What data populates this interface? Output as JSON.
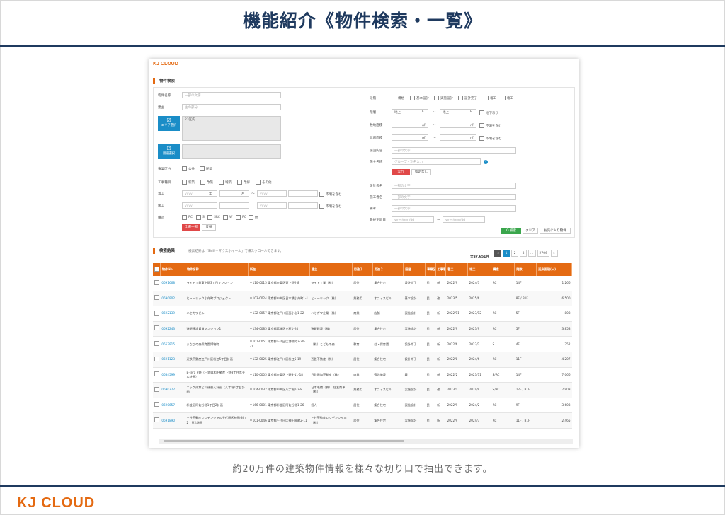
{
  "page": {
    "title": "機能紹介《物件検索・一覧》",
    "caption": "約20万件の建築物件情報を様々な切り口で抽出できます。",
    "footer_brand": "KJ CLOUD"
  },
  "app": {
    "logo": "KJ CLOUD",
    "search_section": "物件検索",
    "results_section": "検索結果",
    "results_hint": "検索結果は「Shift＋マウスホイール」で横スクロールできます。",
    "result_count": "全37,651件"
  },
  "form": {
    "name_label": "物件名称",
    "name_placeholder": "一部の文字",
    "owner_label": "建主",
    "owner_placeholder": "主の部分",
    "area_button": "エリア選択",
    "area_value": "23区内",
    "use_button": "用途選択",
    "public_label": "事業区分",
    "public_opts": [
      "公共",
      "民間"
    ],
    "work_label": "工事種目",
    "work_opts": [
      "新築",
      "改築",
      "増築",
      "改修",
      "その他"
    ],
    "start_label": "着工",
    "end_label": "竣工",
    "yyyy": "yyyy",
    "year": "年",
    "month": "月",
    "tilde": "〜",
    "include_unknown": "不明を含む",
    "struct_label": "構造",
    "struct_opts": [
      "RC",
      "S",
      "SRC",
      "W",
      "PC",
      "他"
    ],
    "clear_all": "全選一部",
    "toggle": "反転",
    "stage_label": "段階",
    "stage_opts": [
      "構想",
      "基本設計",
      "実施設計",
      "設計完了",
      "着工",
      "竣工"
    ],
    "floor_label": "階層",
    "floor_above": "地上",
    "floor_unit": "F",
    "basement": "地下あり",
    "site_label": "敷地面積",
    "total_label": "延床面積",
    "area_unit": "㎡",
    "tsubo_unit": "坪",
    "unknown_incl": "不明を含む",
    "facility_label": "施設内容",
    "facility_placeholder": "一部の文字",
    "builder_label": "施主名称",
    "builder_placeholder": "グループ・別名入力",
    "apply_btn": "実行",
    "reset_btn": "指定なし",
    "designer_label": "設計者名",
    "designer_placeholder": "一部の文字",
    "constructor_label": "施工者名",
    "constructor_placeholder": "一部の文字",
    "note_label": "備考",
    "note_placeholder": "一部の文字",
    "updated_label": "最終更新日",
    "date_placeholder": "yyyy/mm/dd",
    "search_btn": "Q 検索",
    "clear_btn": "クリア",
    "fav_btn": "お気に入り物件"
  },
  "pager": [
    "<",
    "1",
    "2",
    "3",
    "…",
    "2706",
    ">"
  ],
  "table": {
    "headers": [
      "物件No",
      "物件名称",
      "所在",
      "建主",
      "用途１",
      "用途２",
      "段階",
      "事業区分",
      "工事種目",
      "着工",
      "竣工",
      "構造",
      "階数",
      "延床面積(㎡)"
    ],
    "rows": [
      [
        "0691668",
        "ライト工業東上野3丁目マンション",
        "〒110-0015 東京都台東区東上野2-8",
        "ライト工業（株）",
        "居住",
        "集合住宅",
        "設計完了",
        "民",
        "新",
        "2022/9",
        "2024/3",
        "RC",
        "14F",
        "1,266"
      ],
      [
        "0690902",
        "ヒューリック小舟町プロジェクト",
        "〒103-0024 東京都中央区日本橋小舟町1-1",
        "ヒューリック（株）",
        "業務用",
        "オフィスビル",
        "基本設計",
        "民",
        "改",
        "2023/5",
        "2025/6",
        "",
        "8F / B1F",
        "6,500"
      ],
      [
        "0692139",
        "ハセガワビル",
        "〒132-0057 東京都江戸川区西小岩1-22",
        "ハセガワ企業（株）",
        "商業",
        "店舗",
        "実施設計",
        "民",
        "新",
        "2022/11",
        "2023/12",
        "RC",
        "5F",
        "808"
      ],
      [
        "0692243",
        "進研建設賃貸マンション1",
        "〒134-0085 東京都葛飾区立石1-24",
        "進研建設（株）",
        "居住",
        "集合住宅",
        "実施設計",
        "民",
        "新",
        "2022/9",
        "2023/9",
        "RC",
        "5F",
        "3,858"
      ],
      [
        "0657915",
        "まなびの森保育園博物町",
        "〒101-0051 東京都千代田区博物町2-20-31",
        "（株）こどもの森",
        "教育",
        "幼・保育園",
        "設計完了",
        "民",
        "新",
        "2022/6",
        "2023/2",
        "S",
        "4F",
        "752"
      ],
      [
        "0691123",
        "近鉄不動産江戸川区松江5丁目計画",
        "〒132-0025 東京都江戸川区松江5-19",
        "近鉄不動産（株）",
        "居住",
        "集合住宅",
        "設計完了",
        "民",
        "新",
        "2022/8",
        "2024/6",
        "RC",
        "11F",
        "4,207"
      ],
      [
        "0684599",
        "B-tera上野（日鉄興和不動産上野3丁目ホテル計画）",
        "〒110-0005 東京都台東区上野3-11-18",
        "日鉄興和不動産（株）",
        "商業",
        "宿泊施設",
        "着工",
        "民",
        "新",
        "2022/2",
        "2023/11",
        "S/RC",
        "14F",
        "7,066"
      ],
      [
        "0690372",
        "ニッケ東京ビル建替え計画（八丁堀1丁目計画）",
        "〒104-0032 東京都中央区八丁堀1-2-8",
        "日本毛織（株）、住友商事（株）",
        "業務用",
        "オフィスビル",
        "実施設計",
        "民",
        "改",
        "2023/1",
        "2024/9",
        "S/RC",
        "12F / B1F",
        "7,903"
      ],
      [
        "0690657",
        "杉並区阿佐谷北1丁目2計画",
        "〒166-0001 東京都杉並区阿佐谷北1-26",
        "個人",
        "居住",
        "集合住宅",
        "実施設計",
        "民",
        "新",
        "2022/9",
        "2024/2",
        "RC",
        "9F",
        "3,603"
      ],
      [
        "0691890",
        "三井不動産レジデンシャル千代田区神田多町2丁目2計画",
        "〒101-0046 東京都千代田区神田多町2-11",
        "三井不動産レジデンシャル（株）",
        "居住",
        "集合住宅",
        "実施設計",
        "民",
        "新",
        "2022/9",
        "2024/3",
        "RC",
        "11F / B1F",
        "2,465"
      ]
    ]
  },
  "colors": {
    "accent": "#e46a12",
    "navy": "#1f3a5f",
    "blue": "#1a8dc7"
  }
}
